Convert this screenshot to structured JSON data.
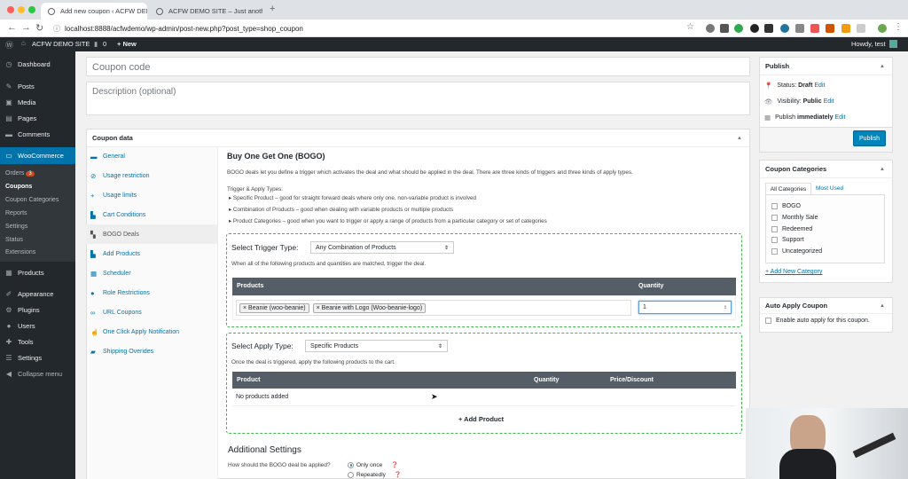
{
  "browser": {
    "tabs": [
      {
        "title": "Add new coupon ‹ ACFW DEMO",
        "close": "×"
      },
      {
        "title": "ACFW DEMO SITE – Just anoth",
        "close": "×"
      }
    ],
    "new_tab": "+",
    "url": "localhost:8888/acfwdemo/wp-admin/post-new.php?post_type=shop_coupon"
  },
  "admin_bar": {
    "site_name": "ACFW DEMO SITE",
    "comments_count": "0",
    "new_label": "+ New",
    "howdy": "Howdy, test"
  },
  "sidebar": {
    "items": [
      {
        "label": "Dashboard",
        "icon": "dashboard-icon"
      },
      {
        "label": "Posts",
        "icon": "pin-icon"
      },
      {
        "label": "Media",
        "icon": "media-icon"
      },
      {
        "label": "Pages",
        "icon": "pages-icon"
      },
      {
        "label": "Comments",
        "icon": "comment-icon"
      },
      {
        "label": "WooCommerce",
        "icon": "woo-icon"
      },
      {
        "label": "Products",
        "icon": "products-icon"
      },
      {
        "label": "Appearance",
        "icon": "brush-icon"
      },
      {
        "label": "Plugins",
        "icon": "plugin-icon"
      },
      {
        "label": "Users",
        "icon": "users-icon"
      },
      {
        "label": "Tools",
        "icon": "wrench-icon"
      },
      {
        "label": "Settings",
        "icon": "settings-icon"
      },
      {
        "label": "Collapse menu",
        "icon": "collapse-icon"
      }
    ],
    "woo_sub": {
      "orders": "Orders",
      "orders_badge": "3",
      "coupons": "Coupons",
      "coupon_categories": "Coupon Categories",
      "reports": "Reports",
      "settings": "Settings",
      "status": "Status",
      "extensions": "Extensions"
    }
  },
  "coupon": {
    "code_placeholder": "Coupon code",
    "desc_placeholder": "Description (optional)"
  },
  "coupon_data": {
    "title": "Coupon data",
    "tabs": [
      "General",
      "Usage restriction",
      "Usage limits",
      "Cart Conditions",
      "BOGO Deals",
      "Add Products",
      "Scheduler",
      "Role Restrictions",
      "URL Coupons",
      "One Click Apply Notification",
      "Shipping Overides"
    ],
    "bogo": {
      "heading": "Buy One Get One (BOGO)",
      "intro": "BOGO deals let you define a trigger which activates the deal and what should be applied in the deal. There are three kinds of triggers and three kinds of apply types.",
      "types_label": "Trigger & Apply Types:",
      "bullets": [
        "Specific Product – good for straight forward deals where only one, non-variable product is involved",
        "Combination of Products – good when dealing with variable products or multiple products",
        "Product Categories – good when you want to trigger or apply a range of products from a particular category or set of categories"
      ],
      "trigger_label": "Select Trigger Type:",
      "trigger_value": "Any Combination of Products",
      "trigger_help": "When all of the following products and quantities are matched, trigger the deal.",
      "trigger_cols": [
        "Products",
        "Quantity"
      ],
      "trigger_tokens": [
        "× Beanie (woo-beanie)",
        "× Beanie with Logo (Woo-beanie-logo)"
      ],
      "trigger_qty": "1",
      "apply_label": "Select Apply Type:",
      "apply_value": "Specific Products",
      "apply_help": "Once the deal is triggered, apply the following products to the cart.",
      "apply_cols": [
        "Product",
        "Quantity",
        "Price/Discount"
      ],
      "apply_empty": "No products added",
      "add_product": "+ Add Product",
      "additional_title": "Additional Settings",
      "how_label": "How should the BOGO deal be applied?",
      "opt_once": "Only once",
      "opt_repeat": "Repeatedly"
    }
  },
  "publish": {
    "title": "Publish",
    "status_label": "Status:",
    "status_value": "Draft",
    "visibility_label": "Visibility:",
    "visibility_value": "Public",
    "publish_label": "Publish",
    "publish_value": "immediately",
    "edit": "Edit",
    "button": "Publish"
  },
  "categories": {
    "title": "Coupon Categories",
    "tab_all": "All Categories",
    "tab_used": "Most Used",
    "items": [
      "BOGO",
      "Monthly Sale",
      "Redeemed",
      "Support",
      "Uncategorized"
    ],
    "add_new": "+ Add New Category"
  },
  "auto_apply": {
    "title": "Auto Apply Coupon",
    "label": "Enable auto apply for this coupon."
  },
  "colors": {
    "admin_dark": "#23282d",
    "accent_blue": "#0073aa",
    "woo_highlight": "#0073aa",
    "dashed_green": "#46b450"
  }
}
